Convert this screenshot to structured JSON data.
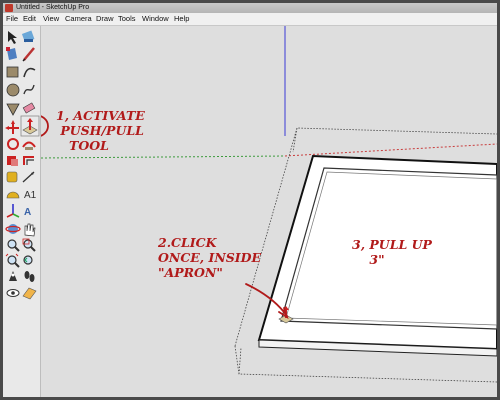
{
  "window": {
    "title": "Untitled - SketchUp Pro"
  },
  "menu": {
    "items": [
      "File",
      "Edit",
      "View",
      "Camera",
      "Draw",
      "Tools",
      "Window",
      "Help"
    ]
  },
  "toolbar": {
    "tools": [
      "select-tool-icon",
      "paint-bucket-tool-icon",
      "make-component-icon",
      "pencil-line-tool-icon",
      "rectangle-tool-icon",
      "arc-tool-icon",
      "circle-tool-icon",
      "freehand-tool-icon",
      "polygon-tool-icon",
      "eraser-tool-icon",
      "move-tool-icon",
      "push-pull-tool-icon",
      "rotate-tool-icon",
      "follow-me-tool-icon",
      "scale-tool-icon",
      "offset-tool-icon",
      "tape-measure-tool-icon",
      "dimension-tool-icon",
      "protractor-tool-icon",
      "text-tool-icon",
      "axes-tool-icon",
      "3d-text-tool-icon",
      "orbit-tool-icon",
      "pan-tool-icon",
      "zoom-tool-icon",
      "zoom-window-tool-icon",
      "zoom-extents-icon",
      "previous-view-icon",
      "position-camera-icon",
      "walk-tool-icon",
      "look-around-icon",
      "section-plane-icon"
    ],
    "active_tool": "push-pull-tool-icon"
  },
  "annotations": {
    "step1": "1, ACTIVATE\n PUSH/PULL\n   TOOL",
    "step2": "2.CLICK\nONCE, INSIDE\n\"APRON\"",
    "step3": "3, PULL UP\n    3\""
  },
  "colors": {
    "annotation": "#b11a1a",
    "canvas_background": "#dedede",
    "blue_axis": "#3a3ad6",
    "green_axis": "#3c9a3c",
    "red_axis": "#c83c3c"
  }
}
